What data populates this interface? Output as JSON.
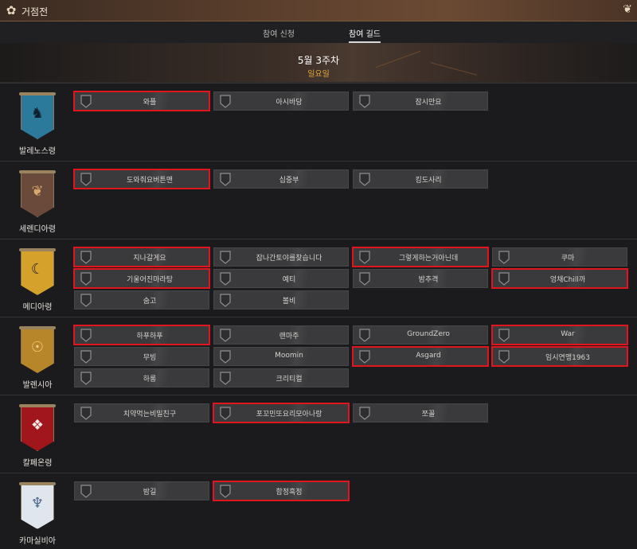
{
  "window": {
    "title": "거점전"
  },
  "tabs": [
    {
      "label": "참여 신청",
      "active": false
    },
    {
      "label": "참여 길드",
      "active": true
    }
  ],
  "banner": {
    "week": "5월 3주차",
    "day": "일요일"
  },
  "colors": {
    "highlight": "#e0151d",
    "day_text": "#e6a53b"
  },
  "regions": [
    {
      "name": "발레노스령",
      "crest_icon": "horse-icon",
      "crest_color": "#2c7a9b",
      "guilds": [
        {
          "name": "와플",
          "highlighted": true
        },
        {
          "name": "아시바당",
          "highlighted": false
        },
        {
          "name": "잠시만요",
          "highlighted": false
        }
      ]
    },
    {
      "name": "세렌디아령",
      "crest_icon": "tree-icon",
      "crest_color": "#6a4a3a",
      "guilds": [
        {
          "name": "도와줘요버튼맨",
          "highlighted": true
        },
        {
          "name": "십중부",
          "highlighted": false
        },
        {
          "name": "킹도사리",
          "highlighted": false
        }
      ]
    },
    {
      "name": "메디아령",
      "crest_icon": "crescent-icon",
      "crest_color": "#d6a12a",
      "guilds": [
        {
          "name": "지나갈게요",
          "highlighted": true
        },
        {
          "name": "잡나간토야를찾습니다",
          "highlighted": false
        },
        {
          "name": "그렇게하는거아닌데",
          "highlighted": true
        },
        {
          "name": "쿠마",
          "highlighted": false
        },
        {
          "name": "기울어진마라탕",
          "highlighted": true
        },
        {
          "name": "예티",
          "highlighted": false
        },
        {
          "name": "밤추격",
          "highlighted": false
        },
        {
          "name": "엉채Chill까",
          "highlighted": true
        },
        {
          "name": "숨고",
          "highlighted": false
        },
        {
          "name": "볼비",
          "highlighted": false
        }
      ]
    },
    {
      "name": "발렌시아",
      "crest_icon": "sun-eye-icon",
      "crest_color": "#b8862a",
      "guilds": [
        {
          "name": "하푸하푸",
          "highlighted": true
        },
        {
          "name": "랜마주",
          "highlighted": false
        },
        {
          "name": "GroundZero",
          "highlighted": false
        },
        {
          "name": "War",
          "highlighted": true
        },
        {
          "name": "무빙",
          "highlighted": false
        },
        {
          "name": "Moomin",
          "highlighted": false
        },
        {
          "name": "Asgard",
          "highlighted": true
        },
        {
          "name": "임시연맹1963",
          "highlighted": true
        },
        {
          "name": "하롱",
          "highlighted": false
        },
        {
          "name": "크리티컬",
          "highlighted": false
        }
      ]
    },
    {
      "name": "칼페온령",
      "crest_icon": "eagle-icon",
      "crest_color": "#a1151c",
      "guilds": [
        {
          "name": "치약먹는비밀친구",
          "highlighted": false
        },
        {
          "name": "포꼬민또요리모아나랑",
          "highlighted": true
        },
        {
          "name": "쪼꼴",
          "highlighted": false
        }
      ]
    },
    {
      "name": "카마실비아",
      "crest_icon": "spirit-tree-icon",
      "crest_color": "#dfe6ee",
      "guilds": [
        {
          "name": "밤길",
          "highlighted": false
        },
        {
          "name": "함정흑정",
          "highlighted": true
        }
      ]
    }
  ]
}
